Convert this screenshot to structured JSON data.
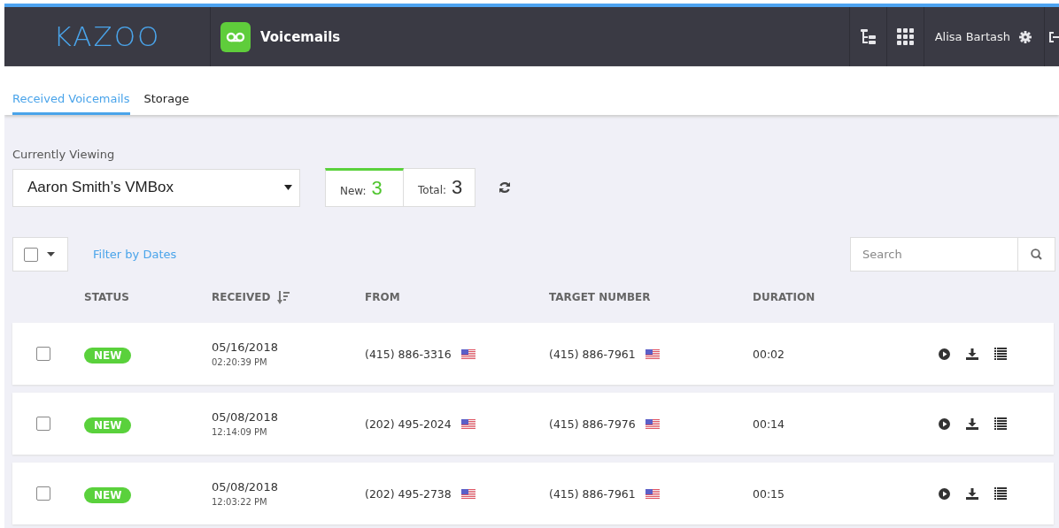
{
  "header": {
    "logo": "KAZOO",
    "app_title": "Voicemails",
    "user_name": "Alisa Bartash"
  },
  "tabs": [
    {
      "label": "Received Voicemails",
      "selected": true
    },
    {
      "label": "Storage",
      "selected": false
    }
  ],
  "viewing": {
    "label": "Currently Viewing",
    "value": "Aaron Smith’s VMBox",
    "new_label": "New:",
    "new_count": "3",
    "total_label": "Total:",
    "total_count": "3"
  },
  "toolbar": {
    "select_all_checked": false,
    "filter_link": "Filter by Dates",
    "search": {
      "placeholder": "Search"
    }
  },
  "table": {
    "columns": [
      "STATUS",
      "RECEIVED",
      "FROM",
      "TARGET NUMBER",
      "DURATION"
    ],
    "rows": [
      {
        "checked": false,
        "status": "NEW",
        "date": "05/16/2018",
        "time": "02:20:39 PM",
        "from": "(415) 886-3316",
        "target": "(415) 886-7961",
        "duration": "00:02"
      },
      {
        "checked": false,
        "status": "NEW",
        "date": "05/08/2018",
        "time": "12:14:09 PM",
        "from": "(202) 495-2024",
        "target": "(415) 886-7976",
        "duration": "00:14"
      },
      {
        "checked": false,
        "status": "NEW",
        "date": "05/08/2018",
        "time": "12:03:22 PM",
        "from": "(202) 495-2738",
        "target": "(415) 886-7961",
        "duration": "00:15"
      }
    ]
  }
}
